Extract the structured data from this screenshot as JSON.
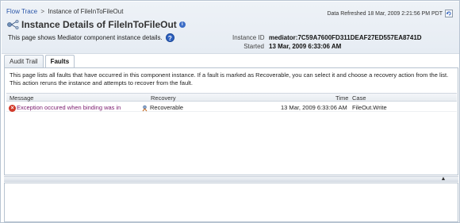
{
  "breadcrumb": {
    "root": "Flow Trace",
    "separator": ">",
    "current": "Instance of FileInToFileOut"
  },
  "refresh": {
    "text": "Data Refreshed 18 Mar, 2009 2:21:56 PM PDT"
  },
  "header": {
    "title": "Instance Details of FileInToFileOut",
    "subtitle": "This page shows Mediator component instance details.",
    "instance_id_label": "Instance ID",
    "instance_id_value": "mediator:7C59A7600FD311DEAF27ED557EA8741D",
    "started_label": "Started",
    "started_value": "13 Mar, 2009 6:33:06 AM"
  },
  "tabs": [
    {
      "label": "Audit Trail",
      "active": false
    },
    {
      "label": "Faults",
      "active": true
    }
  ],
  "faults": {
    "description": "This page lists all faults that have occurred in this component instance. If a fault is marked as Recoverable, you can select it and choose a recovery action from the list. This action reruns the instance and attempts to recover from the fault.",
    "columns": {
      "message": "Message",
      "recovery": "Recovery",
      "time": "Time",
      "case": "Case"
    },
    "rows": [
      {
        "message": "Exception occured when binding was in",
        "recovery": "Recoverable",
        "time": "13 Mar, 2009 6:33:06 AM",
        "case": "FileOut.Write"
      }
    ]
  },
  "colors": {
    "link": "#2a55a8",
    "error_link": "#7a1a6e",
    "error_icon": "#d23a2b",
    "border": "#b7c3d0"
  },
  "icons": {
    "title": "component-icon",
    "info": "info-icon",
    "help": "help-icon",
    "refresh": "refresh-icon",
    "error": "error-icon",
    "recoverable": "recover-icon",
    "splitter": "chevron-up-icon"
  }
}
